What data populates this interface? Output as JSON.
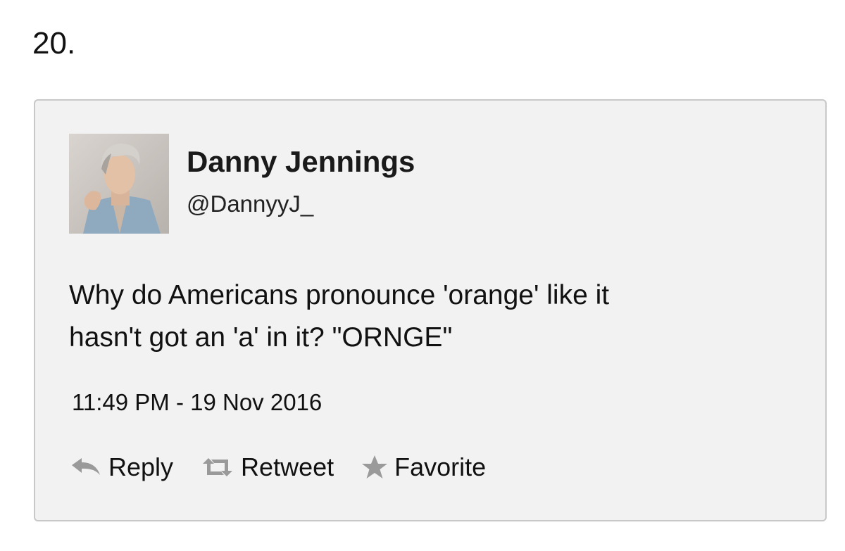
{
  "list": {
    "number": "20."
  },
  "tweet": {
    "author": {
      "display_name": "Danny Jennings",
      "handle": "@DannyyJ_"
    },
    "text_lines": [
      "Why do Americans pronounce 'orange' like it",
      "hasn't got an 'a' in it? \"ORNGE\""
    ],
    "timestamp": "11:49 PM - 19 Nov 2016",
    "actions": [
      {
        "label": "Reply",
        "icon": "reply-arrow-icon"
      },
      {
        "label": "Retweet",
        "icon": "retweet-icon"
      },
      {
        "label": "Favorite",
        "icon": "star-icon"
      }
    ]
  },
  "colors": {
    "card_background": "#f2f2f2",
    "card_border": "#c8c8c8",
    "icon_gray": "#9a9a9a",
    "text": "#111111"
  }
}
